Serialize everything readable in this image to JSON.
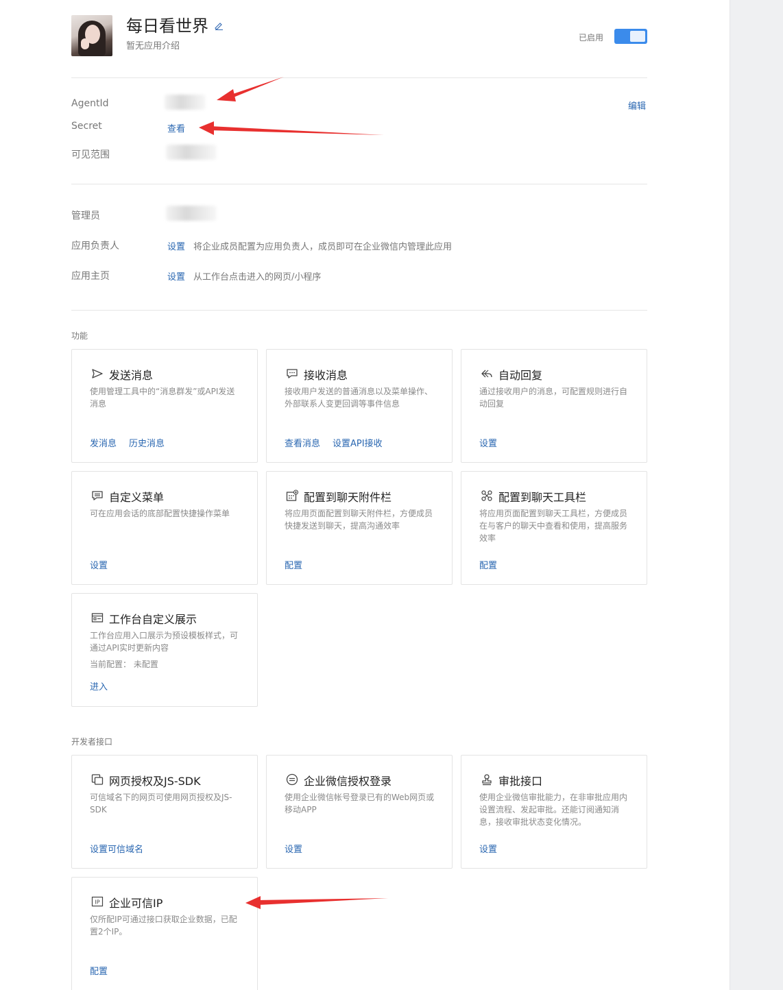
{
  "app": {
    "title": "每日看世界",
    "description": "暂无应用介绍",
    "status_label": "已启用",
    "enabled": true
  },
  "info": {
    "agentid_label": "AgentId",
    "secret_label": "Secret",
    "secret_link": "查看",
    "visible_range_label": "可见范围",
    "edit_link": "编辑"
  },
  "roles": {
    "admin_label": "管理员",
    "owner_label": "应用负责人",
    "owner_link": "设置",
    "owner_hint": "将企业成员配置为应用负责人，成员即可在企业微信内管理此应用",
    "homepage_label": "应用主页",
    "homepage_link": "设置",
    "homepage_hint": "从工作台点击进入的网页/小程序"
  },
  "features": {
    "section_title": "功能",
    "cards": [
      {
        "icon": "send-icon",
        "title": "发送消息",
        "desc": "使用管理工具中的“消息群发”或API发送消息",
        "links": [
          "发消息",
          "历史消息"
        ]
      },
      {
        "icon": "chat-bubble-icon",
        "title": "接收消息",
        "desc": "接收用户发送的普通消息以及菜单操作、外部联系人变更回调等事件信息",
        "links": [
          "查看消息",
          "设置API接收"
        ]
      },
      {
        "icon": "reply-icon",
        "title": "自动回复",
        "desc": "通过接收用户的消息，可配置规则进行自动回复",
        "links": [
          "设置"
        ]
      },
      {
        "icon": "menu-icon",
        "title": "自定义菜单",
        "desc": "可在应用会话的底部配置快捷操作菜单",
        "links": [
          "设置"
        ]
      },
      {
        "icon": "attachment-bar-icon",
        "title": "配置到聊天附件栏",
        "desc": "将应用页面配置到聊天附件栏，方便成员快捷发送到聊天，提高沟通效率",
        "links": [
          "配置"
        ]
      },
      {
        "icon": "toolbar-icon",
        "title": "配置到聊天工具栏",
        "desc": "将应用页面配置到聊天工具栏，方便成员在与客户的聊天中查看和使用，提高服务效率",
        "links": [
          "配置"
        ]
      },
      {
        "icon": "workbench-icon",
        "title": "工作台自定义展示",
        "desc": "工作台应用入口展示为预设模板样式，可通过API实时更新内容",
        "meta": "当前配置： 未配置",
        "links": [
          "进入"
        ]
      }
    ]
  },
  "developer": {
    "section_title": "开发者接口",
    "cards": [
      {
        "icon": "web-auth-icon",
        "title": "网页授权及JS-SDK",
        "desc": "可信域名下的网页可使用网页授权及JS-SDK",
        "links": [
          "设置可信域名"
        ]
      },
      {
        "icon": "login-icon",
        "title": "企业微信授权登录",
        "desc": "使用企业微信帐号登录已有的Web网页或移动APP",
        "links": [
          "设置"
        ]
      },
      {
        "icon": "approval-icon",
        "title": "审批接口",
        "desc": "使用企业微信审批能力，在非审批应用内设置流程、发起审批。还能订阅通知消息，接收审批状态变化情况。",
        "links": [
          "设置"
        ]
      },
      {
        "icon": "ip-icon",
        "title": "企业可信IP",
        "desc": "仅所配IP可通过接口获取企业数据，已配置2个IP。",
        "links": [
          "配置"
        ]
      }
    ]
  },
  "colors": {
    "link": "#2a67b1",
    "toggle": "#3b8beb",
    "annotation_arrow": "#e8302f"
  }
}
